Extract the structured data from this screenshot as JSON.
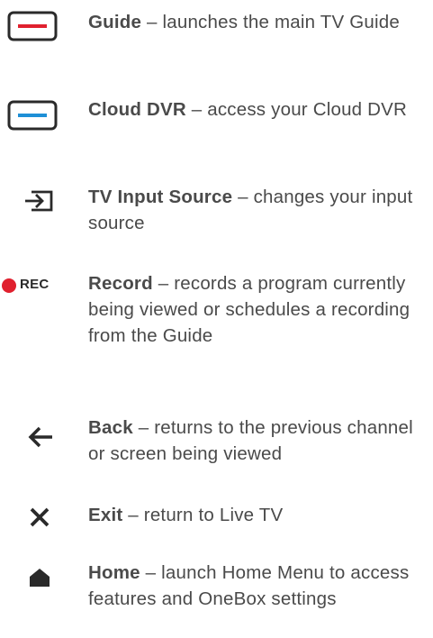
{
  "colors": {
    "text": "#4a4a4a",
    "icon": "#2a2a2a",
    "guide_accent": "#e0202e",
    "dvr_accent": "#1e8fd6",
    "rec_dot": "#e0202e"
  },
  "items": [
    {
      "icon": "guide-icon",
      "term": "Guide",
      "desc": " – launches the main TV Guide"
    },
    {
      "icon": "cloud-dvr-icon",
      "term": "Cloud DVR",
      "desc": " – access your Cloud DVR"
    },
    {
      "icon": "input-source-icon",
      "term": "TV Input Source",
      "desc": " – changes your input source"
    },
    {
      "icon": "rec-icon",
      "icon_label": "REC",
      "term": "Record",
      "desc": " – records a program currently being viewed or schedules a recording from the Guide"
    },
    {
      "icon": "back-arrow-icon",
      "term": "Back",
      "desc": " – returns to the previous channel or screen being viewed"
    },
    {
      "icon": "close-icon",
      "term": "Exit",
      "desc": " – return to Live TV"
    },
    {
      "icon": "home-icon",
      "term": "Home",
      "desc": " – launch Home Menu to access features and OneBox settings"
    }
  ]
}
